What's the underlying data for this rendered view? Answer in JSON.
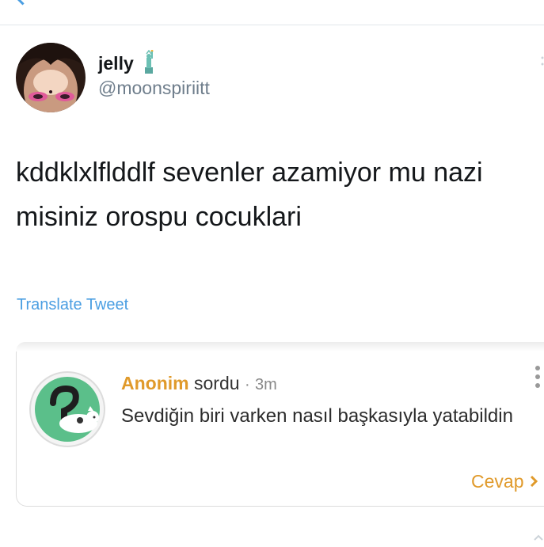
{
  "topbar": {
    "back_icon": "chevron-left-icon"
  },
  "tweet": {
    "display_name": "jelly",
    "name_emoji": "statue-of-liberty-icon",
    "handle": "@moonspiriitt",
    "text": "kddklxlflddlf sevenler azamiyor mu nazi misiniz orospu cocuklari",
    "translate_label": "Translate Tweet"
  },
  "card": {
    "asker": "Anonim",
    "verb": "sordu",
    "separator": "·",
    "time": "3m",
    "question": "Sevdiğin biri varken nasıl başkasıyla yatabildin",
    "reply_label": "Cevap",
    "colors": {
      "accent": "#e09a2b",
      "avatar_bg": "#5bbf8a"
    }
  },
  "colors": {
    "link": "#4a9ee2",
    "muted": "#6f7e8c"
  }
}
